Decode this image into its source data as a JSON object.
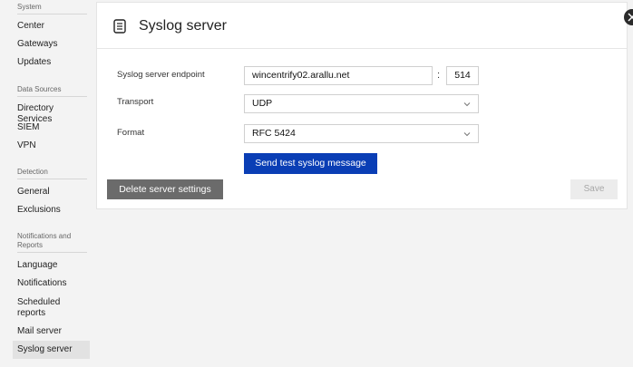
{
  "sidebar": {
    "groups": [
      {
        "title": "System",
        "items": [
          "Center",
          "Gateways",
          "Updates"
        ]
      },
      {
        "title": "Data Sources",
        "items": [
          "Directory Services",
          "SIEM",
          "VPN"
        ]
      },
      {
        "title": "Detection",
        "items": [
          "General",
          "Exclusions"
        ]
      },
      {
        "title": "Notifications and Reports",
        "items": [
          "Language",
          "Notifications",
          "Scheduled reports",
          "Mail server",
          "Syslog server"
        ]
      }
    ],
    "active_item": "Syslog server"
  },
  "page": {
    "title": "Syslog server",
    "title_icon": "document-icon"
  },
  "form": {
    "endpoint_label": "Syslog server endpoint",
    "endpoint_host": "wincentrify02.arallu.net",
    "endpoint_separator": ":",
    "endpoint_port": "514",
    "transport_label": "Transport",
    "transport_value": "UDP",
    "format_label": "Format",
    "format_value": "RFC 5424"
  },
  "buttons": {
    "send_test": "Send test syslog message",
    "delete": "Delete server settings",
    "save": "Save"
  },
  "colors": {
    "primary": "#0a3eb5",
    "secondary": "#6b6b6b",
    "disabled_bg": "#ececec"
  }
}
